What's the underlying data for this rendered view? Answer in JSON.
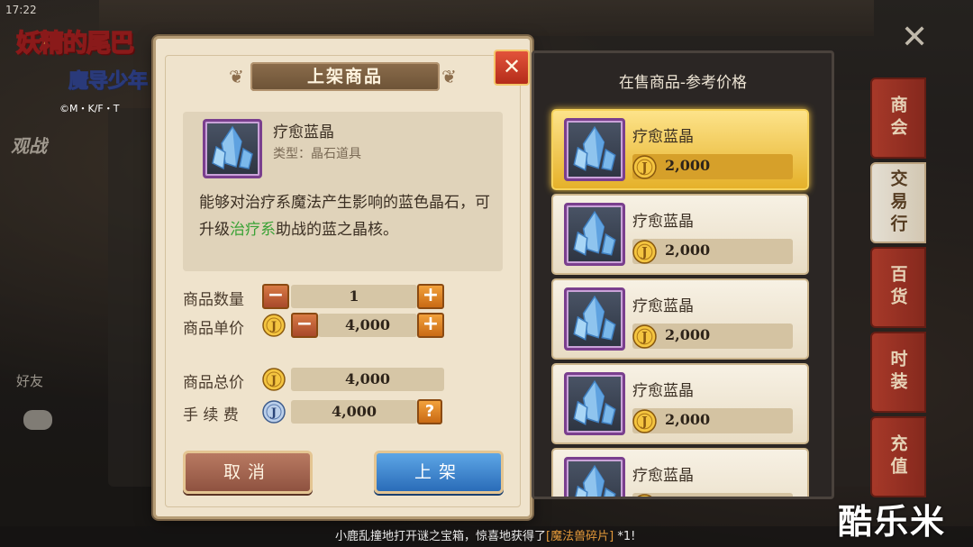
{
  "status_bar": {
    "time": "17:22"
  },
  "logo": {
    "title": "妖精的尾巴",
    "subtitle": "魔导少年",
    "copyright": "©M・K/F・T"
  },
  "background": {
    "spectate_label": "观战",
    "friend_label": "好友"
  },
  "side_tabs": [
    {
      "label": "商会",
      "active": false
    },
    {
      "label": "交易行",
      "active": true
    },
    {
      "label": "百货",
      "active": false
    },
    {
      "label": "时装",
      "active": false
    },
    {
      "label": "充值",
      "active": false
    }
  ],
  "dialog": {
    "title": "上架商品",
    "close_icon": "close-x",
    "item": {
      "name": "疗愈蓝晶",
      "type": "类型：晶石道具",
      "desc_before": "能够对治疗系魔法产生影响的蓝色晶石，可升级",
      "desc_highlight": "治疗系",
      "desc_after": "助战的蓝之晶核。"
    },
    "quantity_label": "商品数量",
    "quantity_value": "1",
    "unit_price_label": "商品单价",
    "unit_price_value": "4,000",
    "total_label": "商品总价",
    "total_value": "4,000",
    "fee_label": "手 续 费",
    "fee_value": "4,000",
    "help_label": "?",
    "minus_label": "−",
    "plus_label": "+",
    "cancel_label": "取消",
    "confirm_label": "上架"
  },
  "market": {
    "title": "在售商品-参考价格",
    "listings": [
      {
        "name": "疗愈蓝晶",
        "price": "2,000",
        "selected": true
      },
      {
        "name": "疗愈蓝晶",
        "price": "2,000",
        "selected": false
      },
      {
        "name": "疗愈蓝晶",
        "price": "2,000",
        "selected": false
      },
      {
        "name": "疗愈蓝晶",
        "price": "2,000",
        "selected": false
      },
      {
        "name": "疗愈蓝晶",
        "price": "",
        "selected": false
      }
    ]
  },
  "ticker": {
    "text_before": "小鹿乱撞地打开谜之宝箱，惊喜地获得了",
    "item": "[魔法兽碎片]",
    "count": "*1!"
  },
  "watermark": "酷乐米",
  "colors": {
    "gold": "#f4c540",
    "accent_green": "#3aa236",
    "tab_red": "#b23b2a",
    "confirm_blue": "#2a6cb8"
  }
}
